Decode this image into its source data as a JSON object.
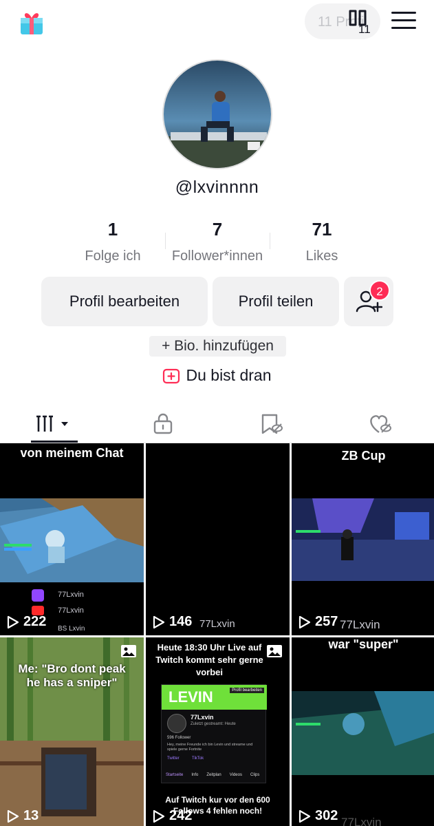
{
  "header": {
    "profile_pill_label": "11 Profil",
    "pill_icon_overlay": "11"
  },
  "profile": {
    "username": "@lxvinnnn",
    "stats": [
      {
        "value": "1",
        "label": "Folge ich"
      },
      {
        "value": "7",
        "label": "Follower*innen"
      },
      {
        "value": "71",
        "label": "Likes"
      }
    ],
    "edit_label": "Profil bearbeiten",
    "share_label": "Profil teilen",
    "friend_badge": "2",
    "bio_label": "+ Bio. hinzufügen",
    "your_turn_label": "Du bist dran"
  },
  "tabs": {
    "icons": [
      "videos-grid-icon",
      "lock-icon",
      "bookmark-icon",
      "liked-heart-icon"
    ]
  },
  "videos": [
    {
      "caption": "von meinem Chat",
      "views": "222",
      "overlay_lines": [
        "77Lxvin",
        "77Lxvin",
        "BS Lxvin"
      ]
    },
    {
      "caption": "",
      "views": "146",
      "handle": "77Lxvin"
    },
    {
      "caption": "ZB Cup",
      "views": "257",
      "handle": "77Lxvin"
    },
    {
      "caption": "Me: \"Bro dont peak he has a sniper\"",
      "views": "13"
    },
    {
      "caption": "Heute 18:30 Uhr Live auf Twitch kommt sehr gerne vorbei",
      "views": "242",
      "bottom_caption": "Auf Twitch kur vor den 600 Follows 4 fehlen noch!",
      "card": {
        "banner": "LEVIN",
        "banner_button": "Profil bearbeiten",
        "name": "77Lxvin",
        "status": "Zuletzt gestreamt: Heute",
        "followers": "596 Follower",
        "bio": "Hey, meine Freunde ich bin Levin und streame und spiele gerne Fortnite",
        "links": [
          "Twitter",
          "TikTok"
        ],
        "nav": [
          "Startseite",
          "Info",
          "Zeitplan",
          "Videos",
          "Clips"
        ]
      }
    },
    {
      "caption": "war \"super\"",
      "views": "302",
      "handle": "77Lxvin"
    }
  ],
  "colors": {
    "accent": "#fe2c55",
    "text": "#161823",
    "muted": "#75767c",
    "button_bg": "#f1f1f2"
  }
}
